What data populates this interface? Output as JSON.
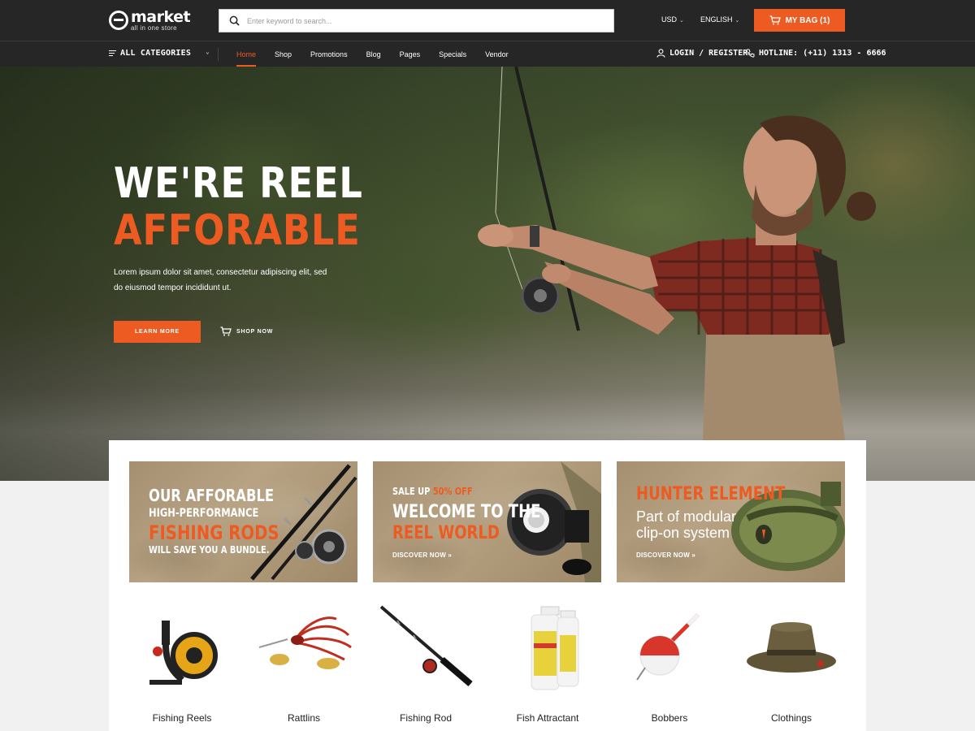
{
  "brand": {
    "name": "market",
    "tagline": "all in one store"
  },
  "search": {
    "placeholder": "Enter keyword to search..."
  },
  "top_controls": {
    "currency": "USD",
    "language": "ENGLISH",
    "bag_label": "MY BAG (1)"
  },
  "nav": {
    "all_categories": "ALL CATEGORIES",
    "items": [
      {
        "label": "Home",
        "active": true
      },
      {
        "label": "Shop"
      },
      {
        "label": "Promotions"
      },
      {
        "label": "Blog"
      },
      {
        "label": "Pages"
      },
      {
        "label": "Specials"
      },
      {
        "label": "Vendor"
      }
    ],
    "login": "LOGIN / REGISTER",
    "hotline": "HOTLINE: (+11) 1313 - 6666"
  },
  "hero": {
    "title_line1": "WE'RE REEL",
    "title_line2": "AFFORABLE",
    "description": "Lorem ipsum dolor sit amet, consectetur adipiscing elit, sed do eiusmod tempor incididunt ut.",
    "learn_more": "LEARN MORE",
    "shop_now": "SHOP NOW"
  },
  "banners": [
    {
      "line1": "OUR AFFORABLE",
      "line2": "HIGH-PERFORMANCE",
      "line3": "FISHING RODS",
      "line4": "WILL SAVE YOU A BUNDLE."
    },
    {
      "sale_prefix": "SALE UP",
      "sale_value": "50% OFF",
      "line1": "WELCOME TO THE",
      "line2": "REEL WORLD",
      "cta": "DISCOVER NOW »"
    },
    {
      "line1": "HUNTER ELEMENT",
      "line2": "Part of modular",
      "line3": "clip-on system",
      "cta": "DISCOVER NOW »"
    }
  ],
  "categories": [
    {
      "label": "Fishing Reels",
      "icon": "fishing-reel"
    },
    {
      "label": "Rattlins",
      "icon": "spinner-lure"
    },
    {
      "label": "Fishing Rod",
      "icon": "fishing-rod"
    },
    {
      "label": "Fish Attractant",
      "icon": "attractant-bottles"
    },
    {
      "label": "Bobbers",
      "icon": "bobber"
    },
    {
      "label": "Clothings",
      "icon": "bucket-hat"
    }
  ],
  "colors": {
    "accent": "#ee5b22",
    "header_bg": "#262626",
    "banner_bg": "#b09a7a"
  }
}
